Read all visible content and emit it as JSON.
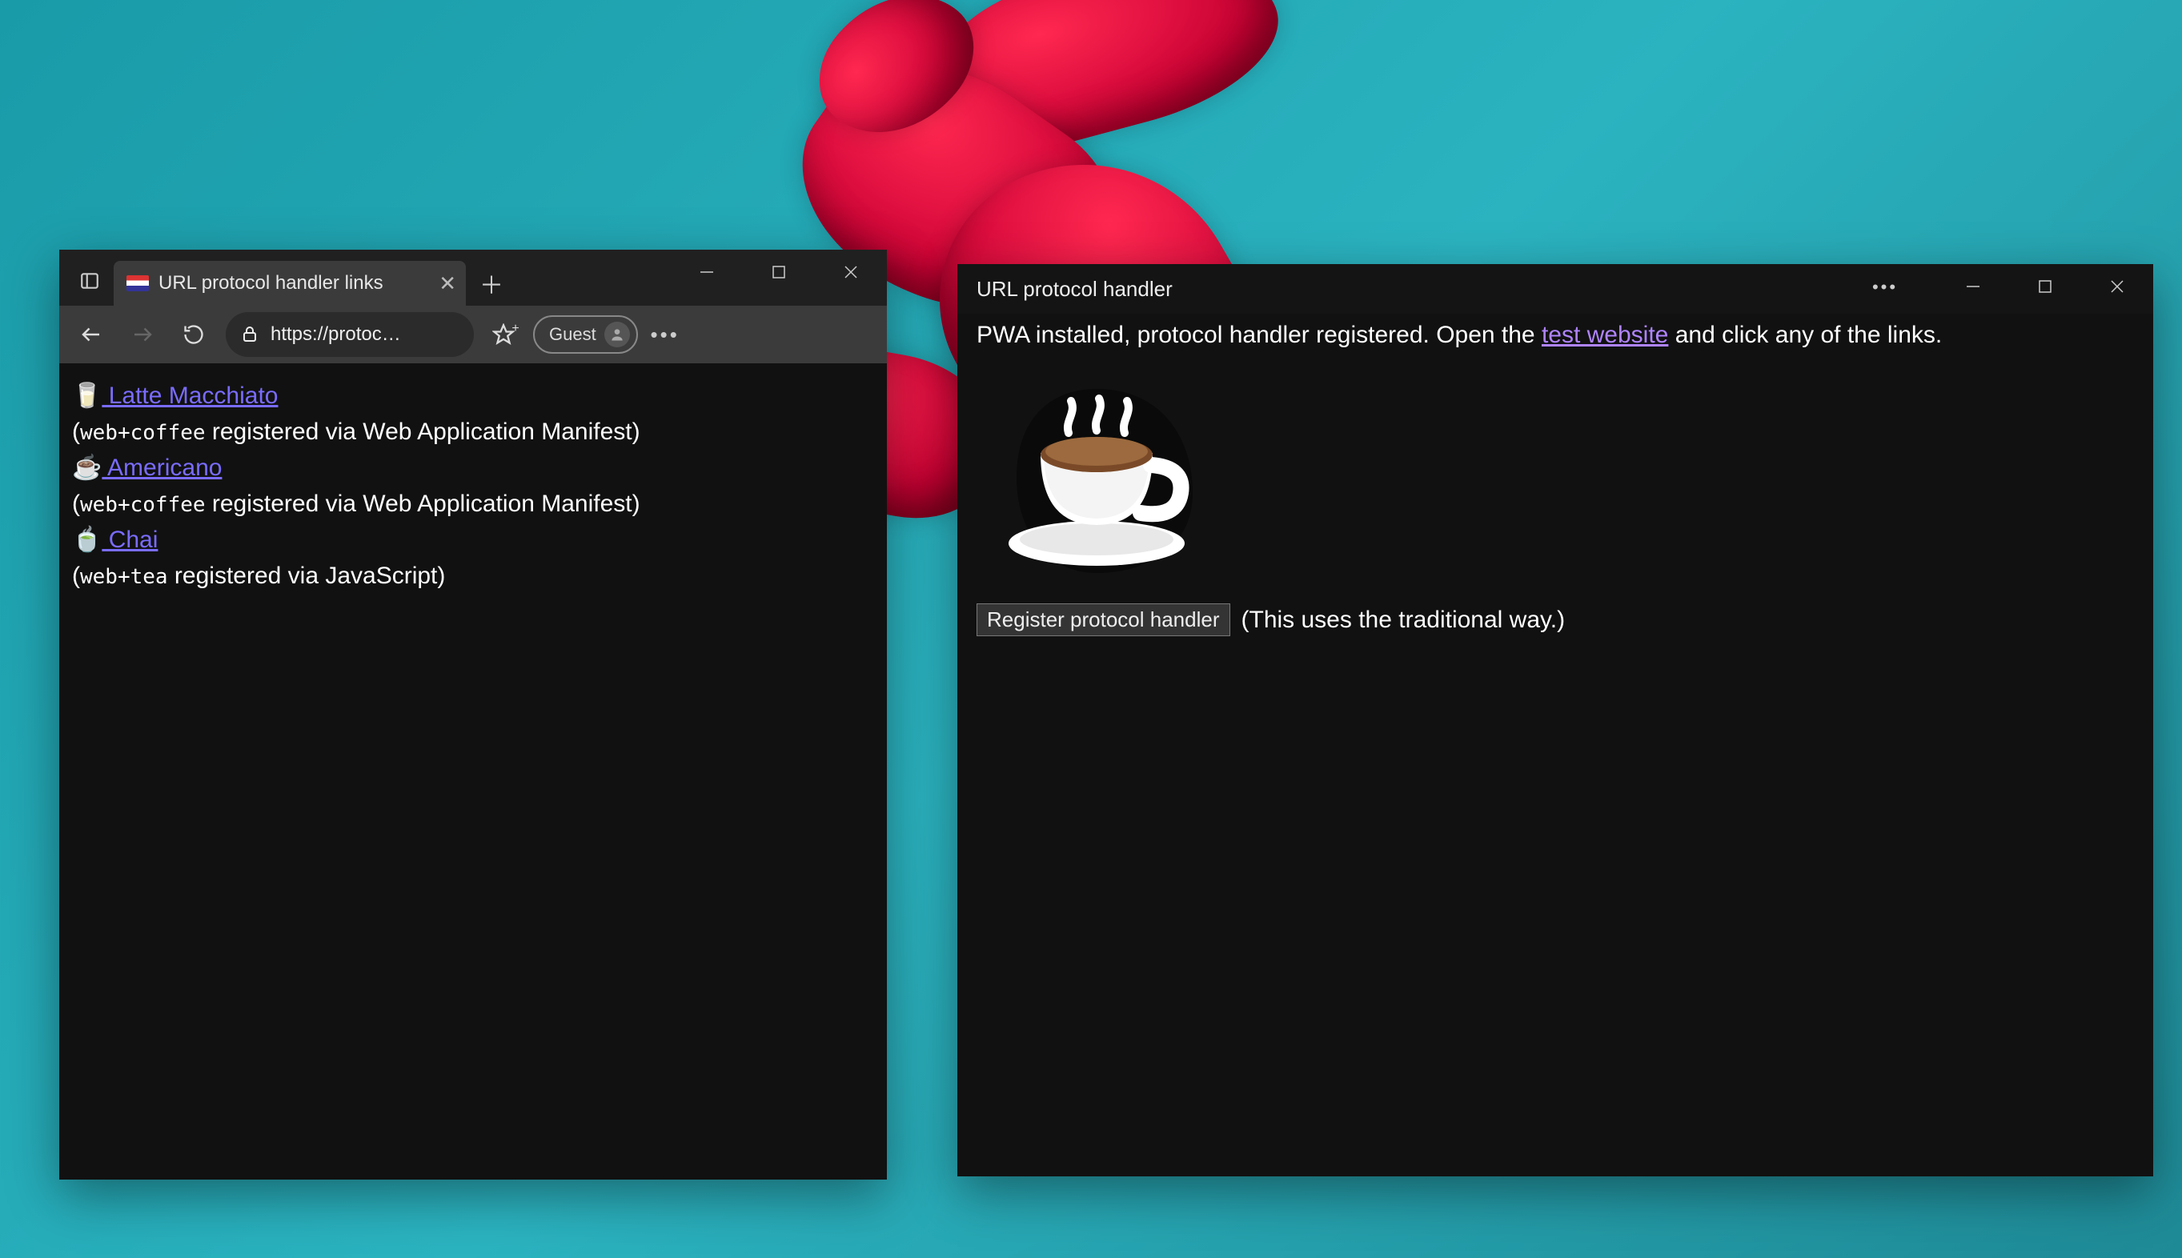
{
  "browser": {
    "tab_title": "URL protocol handler links",
    "address_url": "https://protoc…",
    "guest_label": "Guest",
    "links": [
      {
        "emoji": "🥛",
        "label": " Latte Macchiato",
        "protocol": "web+coffee",
        "via": " registered via Web Application Manifest)"
      },
      {
        "emoji": "☕",
        "label": " Americano",
        "protocol": "web+coffee",
        "via": " registered via Web Application Manifest)"
      },
      {
        "emoji": "🍵",
        "label": " Chai",
        "protocol": "web+tea",
        "via": " registered via JavaScript)"
      }
    ]
  },
  "pwa": {
    "title": "URL protocol handler",
    "status_prefix": "PWA installed, protocol handler registered. Open the ",
    "status_link": "test website",
    "status_suffix": " and click any of the links.",
    "button_label": "Register protocol handler",
    "button_note": "(This uses the traditional way.)"
  }
}
